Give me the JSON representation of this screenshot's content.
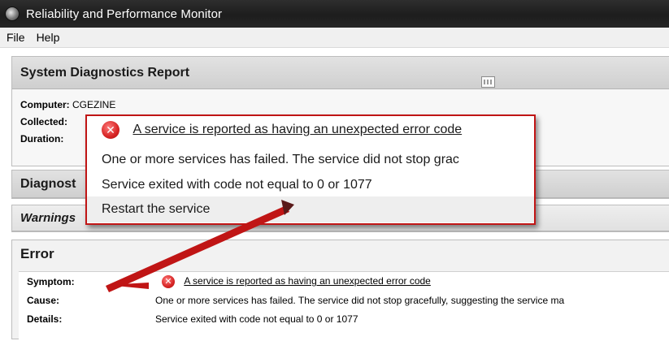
{
  "window": {
    "title": "Reliability and Performance Monitor"
  },
  "menu": [
    {
      "label": "File"
    },
    {
      "label": "Help"
    }
  ],
  "report": {
    "title": "System Diagnostics Report",
    "computer_label": "Computer:",
    "computer_value": "CGEZINE",
    "collected_label": "Collected:",
    "duration_label": "Duration:"
  },
  "sections": {
    "diagnostics_partial": "Diagnost",
    "warnings_partial": "Warnings"
  },
  "error": {
    "title": "Error",
    "symptom_label": "Symptom:",
    "symptom_value": "A service is reported as having an unexpected error code",
    "cause_label": "Cause:",
    "cause_value": "One or more services has failed. The service did not stop gracefully, suggesting the service ma",
    "details_label": "Details:",
    "details_value": "Service exited with code not equal to 0 or 1077"
  },
  "callout": {
    "symptom": "A service is reported as having an unexpected error code",
    "cause": "One or more services has failed. The service did not stop grac",
    "details": "Service exited with code not equal to 0 or 1077",
    "resolution": "Restart the service"
  },
  "colors": {
    "titlebar": "#1d1d1d",
    "callout_border": "#c01515",
    "error_icon": "#d62424",
    "arrow": "#c01515"
  },
  "icons": {
    "app": "reliability-monitor-icon",
    "error": "error-x-circle-icon",
    "report": "report-grid-icon"
  }
}
